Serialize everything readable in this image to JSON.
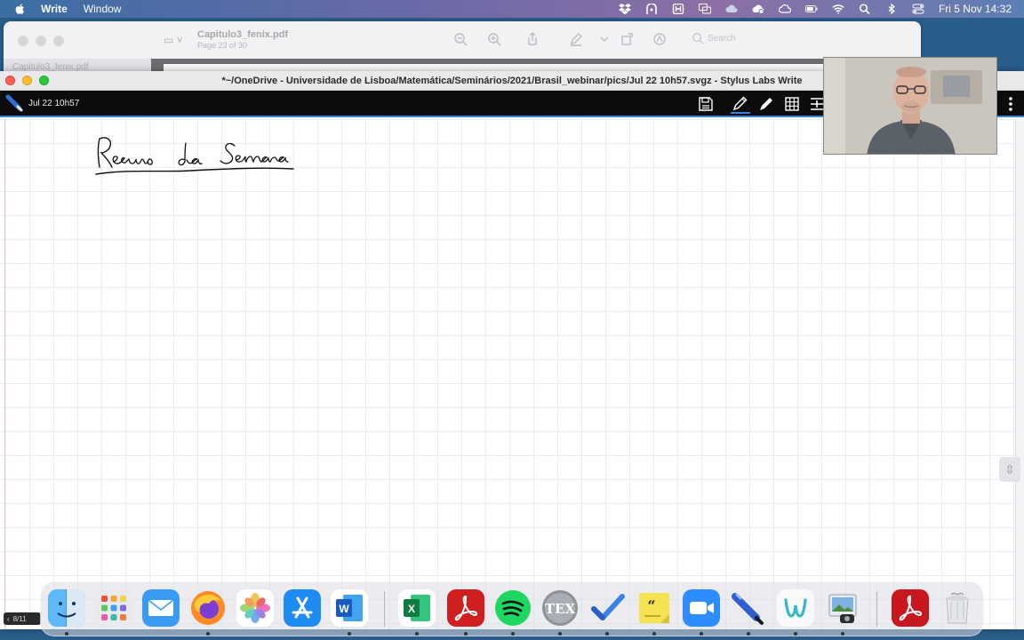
{
  "menubar": {
    "app_name": "Write",
    "menus": [
      "Window"
    ],
    "status_icons": [
      "dropbox-icon",
      "vpn-icon",
      "app-icon",
      "screen-mirror-icon",
      "cloud-upload-icon",
      "creative-cloud-icon",
      "icloud-icon",
      "battery-icon",
      "wifi-icon",
      "spotlight-icon",
      "bluetooth-icon",
      "control-center-icon"
    ],
    "clock": "Fri 5 Nov  14:32"
  },
  "preview": {
    "doc_title": "Capitulo3_fenix.pdf",
    "doc_subtitle": "Page 23 of 30",
    "search_placeholder": "Search",
    "tab_label": "Capitulo3_fenix.pdf"
  },
  "write": {
    "window_title": "*~/OneDrive - Universidade de Lisboa/Matemática/Seminários/2021/Brasil_webinar/pics/Jul 22 10h57.svgz - Stylus Labs Write",
    "doc_name": "Jul 22 10h57",
    "handwritten_text": "Resumo da Semana",
    "page_indicator": "8/11",
    "toolbar": [
      "save-icon",
      "pen-icon",
      "highlighter-icon",
      "grid-icon",
      "insert-space-icon",
      "menu-icon"
    ]
  },
  "dock": {
    "apps": [
      "Finder",
      "Launchpad",
      "Mail",
      "Firefox",
      "Photos",
      "App Store",
      "Microsoft Word",
      "Microsoft Excel",
      "Adobe Acrobat",
      "Spotify",
      "TeXShop",
      "Things",
      "Stickies",
      "Zoom",
      "Stylus Labs Write",
      "Wunderbucket",
      "Preview",
      "Adobe Acrobat Reader",
      "Trash"
    ]
  },
  "colors": {
    "toolbar_bg": "#0c0c0c",
    "accent": "#3a82d6",
    "grid_line": "#e9edf4"
  }
}
